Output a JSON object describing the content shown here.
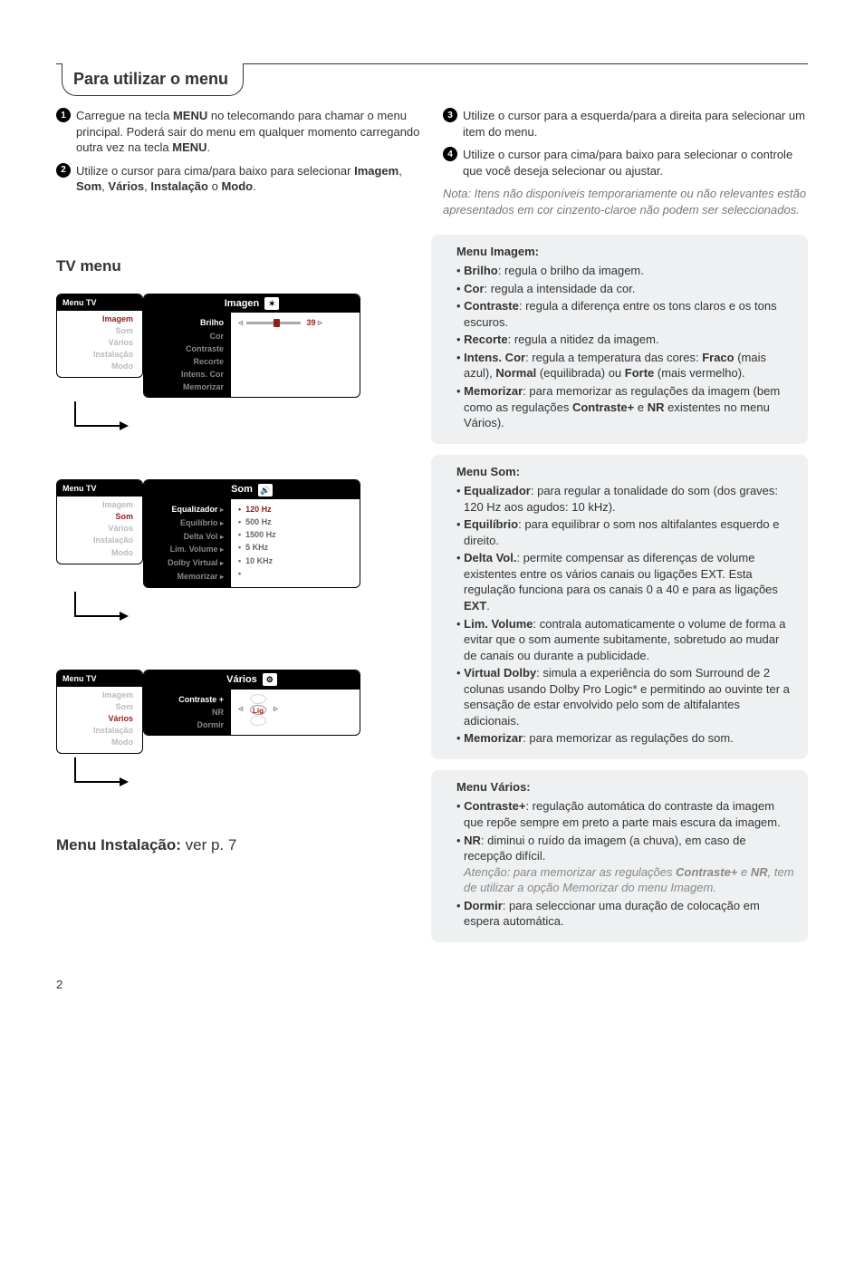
{
  "title": "Para utilizar o menu",
  "steps_left": [
    {
      "n": "1",
      "html": "Carregue na tecla <b>MENU</b> no telecomando para chamar o menu principal. Poderá sair do menu em qualquer momento carregando outra vez na tecla <b>MENU</b>."
    },
    {
      "n": "2",
      "html": "Utilize o cursor para cima/para baixo para selecionar <b>Imagem</b>, <b>Som</b>, <b>Vários</b>, <b>Instalação</b> o <b>Modo</b>."
    }
  ],
  "steps_right": [
    {
      "n": "3",
      "html": "Utilize o cursor para a esquerda/para a direita para selecionar um item do menu."
    },
    {
      "n": "4",
      "html": "Utilize o cursor para cima/para baixo para selecionar o controle que você deseja selecionar ou ajustar."
    }
  ],
  "note": "Nota: Itens não disponíveis temporariamente ou não relevantes estão apresentados em cor cinzento-claroe não podem ser seleccionados.",
  "tv_menu_heading": "TV menu",
  "diag1": {
    "menuHead": "Menu TV",
    "menuItems": [
      "Imagem",
      "Som",
      "Vários",
      "Instalação",
      "Modo"
    ],
    "active": 0,
    "paneHead": "Imagen",
    "paneIcon": "✶",
    "leftRows": [
      "Brilho",
      "Cor",
      "Contraste",
      "Recorte",
      "Intens. Cor",
      "Memorizar"
    ],
    "leftActive": 0,
    "rightValue": "39"
  },
  "diag2": {
    "menuHead": "Menu TV",
    "menuItems": [
      "Imagem",
      "Som",
      "Vários",
      "Instalação",
      "Modo"
    ],
    "active": 1,
    "paneHead": "Som",
    "paneIcon": "🔊",
    "leftRows": [
      "Equalizador",
      "Equilíbrio",
      "Delta Vol",
      "Lim. Volume",
      "Dolby Virtual",
      "Memorizar"
    ],
    "leftActive": 0,
    "rightRows": [
      "120 Hz",
      "500 Hz",
      "1500 Hz",
      "5 KHz",
      "10 KHz",
      ""
    ]
  },
  "diag3": {
    "menuHead": "Menu TV",
    "menuItems": [
      "Imagem",
      "Som",
      "Vários",
      "Instalação",
      "Modo"
    ],
    "active": 2,
    "paneHead": "Vários",
    "paneIcon": "⚙",
    "leftRows": [
      "Contraste +",
      "NR",
      "Dormir"
    ],
    "leftActive": 0,
    "rightValue": "Lig"
  },
  "inst_heading_pre": "Menu Instalação: ",
  "inst_heading_post": "ver p. 7",
  "box_imagem": {
    "title": "Menu Imagem:",
    "items": [
      "<b>Brilho</b>: regula o brilho da imagem.",
      "<b>Cor</b>: regula a intensidade da cor.",
      "<b>Contraste</b>: regula a diferença entre os tons claros e os tons escuros.",
      "<b>Recorte</b>: regula a nitidez da imagem.",
      "<b>Intens. Cor</b>: regula a temperatura das cores: <b>Fraco</b> (mais azul), <b>Normal</b> (equilibrada) ou <b>Forte</b> (mais vermelho).",
      "<b>Memorizar</b>: para memorizar as regulações da imagem (bem como as regulações <b>Contraste+</b> e <b>NR</b> existentes no menu Vários)."
    ]
  },
  "box_som": {
    "title": "Menu Som:",
    "items": [
      "<b>Equalizador</b>: para regular a tonalidade do som (dos graves: 120 Hz aos agudos: 10 kHz).",
      "<b>Equilíbrio</b>: para equilibrar o som nos altifalantes esquerdo e direito.",
      "<b>Delta Vol.</b>: permite compensar as diferenças de volume existentes entre os vários canais ou ligações EXT. Esta regulação funciona para os canais 0 a 40 e para as ligações <b>EXT</b>.",
      "<b>Lim. Volume</b>: contrala automaticamente o volume de forma a evitar que o som aumente subitamente, sobretudo ao mudar de canais ou durante a publicidade.",
      "<b>Virtual Dolby</b>: simula a experiência do som Surround de 2 colunas usando Dolby Pro Logic* e permitindo ao ouvinte ter a sensação de estar envolvido pelo som de altifalantes adicionais.",
      "<b>Memorizar</b>: para memorizar as regulações do som."
    ]
  },
  "box_varios": {
    "title": "Menu Vários:",
    "items": [
      "<b>Contraste+</b>: regulação automática do contraste da imagem que repõe sempre em preto a parte mais escura da imagem.",
      "<b>NR</b>: diminui o ruído da imagem (a chuva), em caso de recepção difícil.<br><span class=\"sub-note\">Atenção: para memorizar as regulações <b>Contraste+</b> e <b>NR</b>, tem de utilizar a opção Memorizar do menu Imagem.</span>",
      "<b>Dormir</b>: para seleccionar uma duração de colocação em espera automática."
    ]
  },
  "page": "2"
}
